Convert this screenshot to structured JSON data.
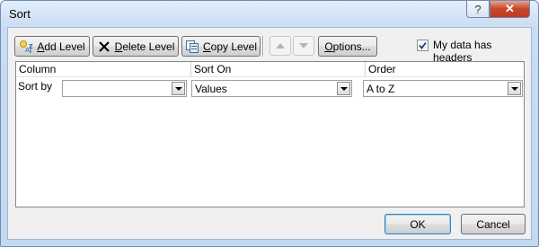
{
  "window": {
    "title": "Sort",
    "help_label": "?",
    "close_label": "✕"
  },
  "toolbar": {
    "add_level": {
      "prefix": "",
      "accel": "A",
      "rest": "dd Level"
    },
    "delete_level": {
      "prefix": "",
      "accel": "D",
      "rest": "elete Level"
    },
    "copy_level": {
      "prefix": "",
      "accel": "C",
      "rest": "opy Level"
    },
    "options": {
      "prefix": "",
      "accel": "O",
      "rest": "ptions..."
    },
    "move_up_icon": "triangle-up-icon",
    "move_down_icon": "triangle-down-icon"
  },
  "headers_checkbox": {
    "checked": true,
    "prefix": "My data has ",
    "accel": "h",
    "rest": "eaders"
  },
  "grid": {
    "columns": [
      "Column",
      "Sort On",
      "Order"
    ],
    "rows": [
      {
        "label": "Sort by",
        "column_value": "",
        "sort_on_value": "Values",
        "order_value": "A to Z"
      }
    ]
  },
  "footer": {
    "ok_label": "OK",
    "cancel_label": "Cancel"
  },
  "colors": {
    "accent": "#3c7fb1",
    "close_red": "#c7452a",
    "frame": "#c3d8f1"
  }
}
